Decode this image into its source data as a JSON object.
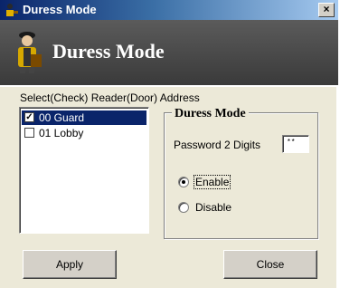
{
  "window": {
    "title": "Duress Mode",
    "close_label": "×"
  },
  "banner": {
    "title": "Duress Mode"
  },
  "reader_group": {
    "label": "Select(Check) Reader(Door) Address",
    "items": [
      {
        "label": "00 Guard",
        "checked": true,
        "selected": true
      },
      {
        "label": "01 Lobby",
        "checked": false,
        "selected": false
      }
    ]
  },
  "duress": {
    "legend": "Duress Mode",
    "password_label": "Password 2 Digits",
    "password_value": "**",
    "options": [
      {
        "label": "Enable",
        "selected": true
      },
      {
        "label": "Disable",
        "selected": false
      }
    ]
  },
  "buttons": {
    "apply": "Apply",
    "close": "Close"
  },
  "colors": {
    "title_bar": "#0a246a",
    "banner": "#4a4a4a",
    "selection": "#0a246a",
    "face": "#ece9d8"
  },
  "icons": {
    "window_icon": "user-key-icon",
    "banner_icon": "user-key-icon"
  }
}
